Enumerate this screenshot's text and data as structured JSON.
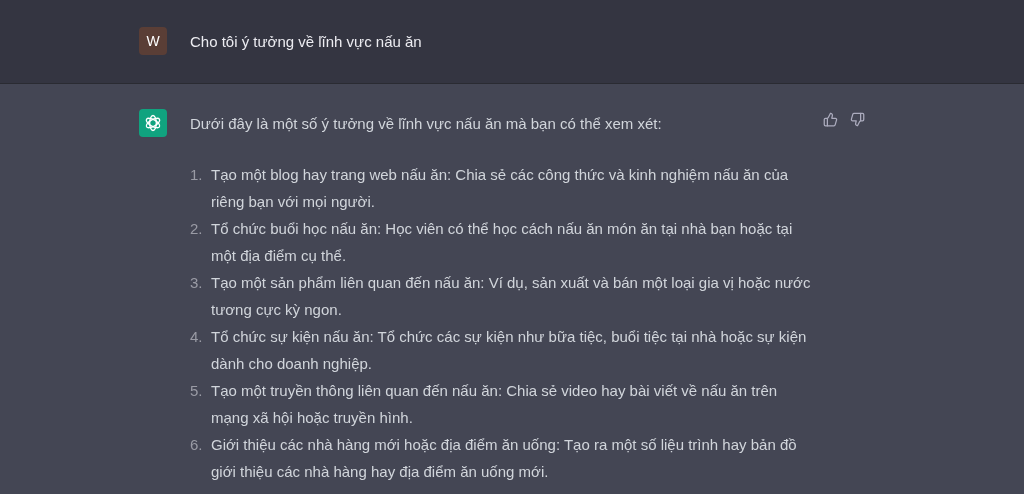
{
  "user_message": {
    "avatar": "W",
    "text": "Cho tôi ý tưởng về lĩnh vực nấu ăn"
  },
  "assistant_message": {
    "intro": "Dưới đây là một số ý tưởng về lĩnh vực nấu ăn mà bạn có thể xem xét:",
    "items": [
      {
        "number": "1.",
        "text": "Tạo một blog hay trang web nấu ăn: Chia sẻ các công thức và kinh nghiệm nấu ăn của riêng bạn với mọi người."
      },
      {
        "number": "2.",
        "text": "Tổ chức buổi học nấu ăn: Học viên có thể học cách nấu ăn món ăn tại nhà bạn hoặc tại một địa điểm cụ thể."
      },
      {
        "number": "3.",
        "text": "Tạo một sản phẩm liên quan đến nấu ăn: Ví dụ, sản xuất và bán một loại gia vị hoặc nước tương cực kỳ ngon."
      },
      {
        "number": "4.",
        "text": "Tổ chức sự kiện nấu ăn: Tổ chức các sự kiện như bữa tiệc, buổi tiệc tại nhà hoặc sự kiện dành cho doanh nghiệp."
      },
      {
        "number": "5.",
        "text": "Tạo một truyền thông liên quan đến nấu ăn: Chia sẻ video hay bài viết về nấu ăn trên mạng xã hội hoặc truyền hình."
      },
      {
        "number": "6.",
        "text": "Giới thiệu các nhà hàng mới hoặc địa điểm ăn uống: Tạo ra một số liệu trình hay bản đồ giới thiệu các nhà hàng hay địa điểm ăn uống mới."
      }
    ]
  }
}
